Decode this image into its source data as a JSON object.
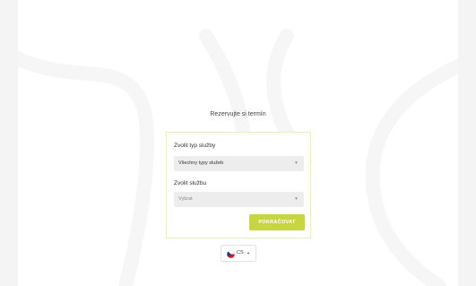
{
  "booking": {
    "title": "Rezervujte si termín",
    "service_type": {
      "label": "Zvolit typ služby",
      "selected": "Všechny typy služeb"
    },
    "service": {
      "label": "Zvolit službu",
      "placeholder": "Vybrat"
    },
    "continue_label": "POKRAČOVAT"
  },
  "language": {
    "code": "CS",
    "icon": "czech-flag-icon"
  },
  "colors": {
    "accent": "#c7d640",
    "card_border": "#e7efc3",
    "field_bg": "#ededed"
  }
}
